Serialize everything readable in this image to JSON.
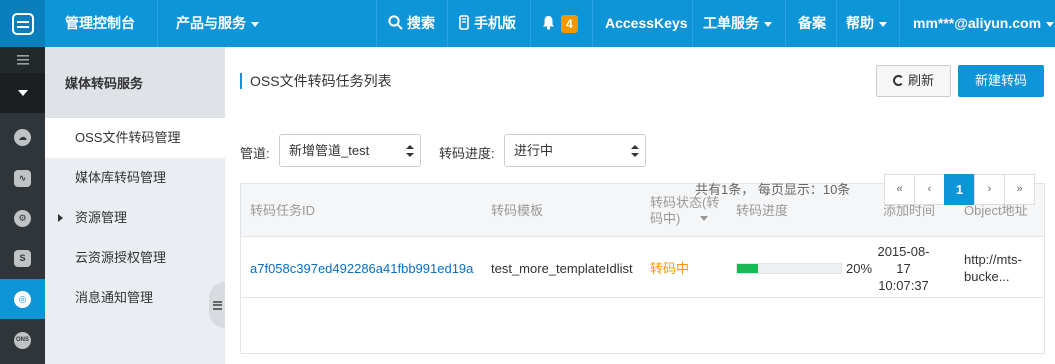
{
  "topbar": {
    "brand": "管理控制台",
    "products": "产品与服务",
    "search": "搜索",
    "mobile": "手机版",
    "notif_count": "4",
    "accesskeys": "AccessKeys",
    "ticket": "工单服务",
    "beian": "备案",
    "help": "帮助",
    "account": "mm***@aliyun.com"
  },
  "iconbar": {
    "items": [
      "menu-toggle",
      "collapse",
      "cloud",
      "monitor",
      "settings",
      "storage",
      "media-transcode",
      "ons"
    ],
    "ons_label": "ONS"
  },
  "menu": {
    "title": "媒体转码服务",
    "items": [
      {
        "label": "OSS文件转码管理",
        "active": true
      },
      {
        "label": "媒体库转码管理"
      },
      {
        "label": "资源管理",
        "expandable": true
      },
      {
        "label": "云资源授权管理"
      },
      {
        "label": "消息通知管理"
      }
    ]
  },
  "main": {
    "title": "OSS文件转码任务列表",
    "refresh_label": "刷新",
    "new_label": "新建转码",
    "filters": {
      "pipeline_label": "管道:",
      "pipeline_value": "新增管道_test",
      "progress_label": "转码进度:",
      "progress_value": "进行中"
    },
    "table": {
      "columns": [
        "转码任务ID",
        "转码模板",
        "转码状态(转码中)",
        "转码进度",
        "添加时间",
        "Object地址"
      ],
      "rows": [
        {
          "id": "a7f058c397ed492286a41fbb991ed19a",
          "template": "test_more_templateIdlist",
          "status": "转码中",
          "progress": 20,
          "progress_text": "20%",
          "date": "2015-08-17",
          "time": "10:07:37",
          "object_line1": "http://mts-",
          "object_line2": "bucke..."
        }
      ]
    },
    "pager": {
      "info": "共有1条，  每页显示：10条",
      "first": "«",
      "prev": "‹",
      "current": "1",
      "next": "›",
      "last": "»"
    }
  },
  "colors": {
    "brand_blue": "#0d95d8",
    "sidebar_dark": "#2f3539",
    "status_orange": "#f39800",
    "progress_green": "#19b955",
    "link_blue": "#0a6ec4"
  }
}
